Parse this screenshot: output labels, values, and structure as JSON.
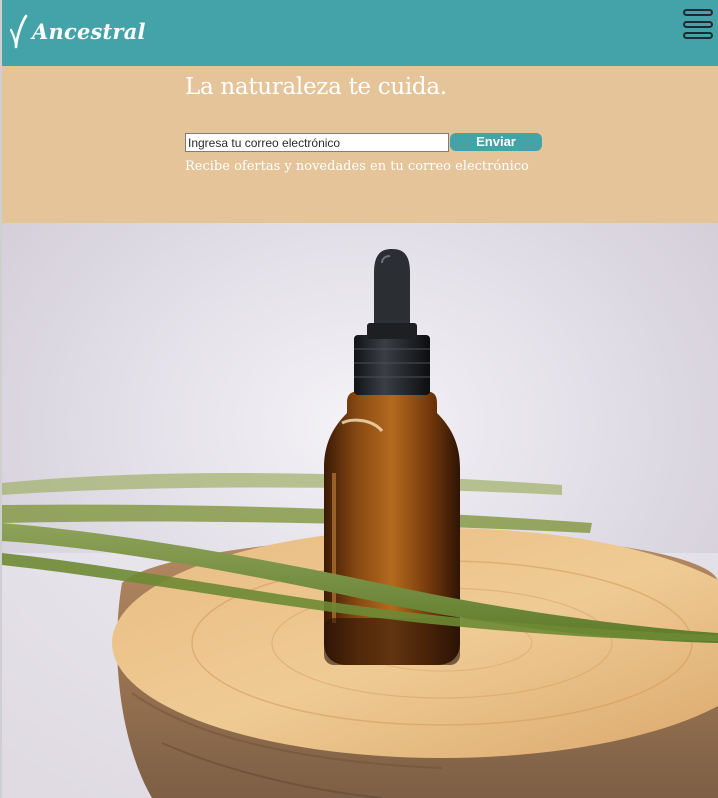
{
  "header": {
    "brand": "Ancestral",
    "menu_icon": "hamburger-menu-icon",
    "background_color": "#43a3a8"
  },
  "newsletter": {
    "title": "La naturaleza te cuida.",
    "email_placeholder": "Ingresa tu correo electrónico",
    "email_value": "",
    "submit_label": "Enviar",
    "note": "Recibe ofertas y novedades en tu correo electrónico",
    "background_color": "#e4c498",
    "accent_color": "#43a3a8"
  },
  "hero": {
    "subject": "amber-dropper-bottle-on-wood-slice"
  }
}
